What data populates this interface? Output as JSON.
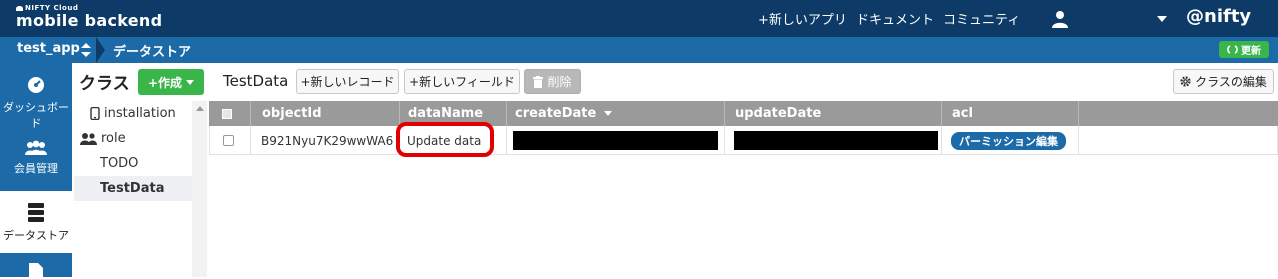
{
  "header": {
    "logo_small": "NIFTY Cloud",
    "logo_big": "mobile backend",
    "nav": [
      {
        "label": "+新しいアプリ"
      },
      {
        "label": "ドキュメント"
      },
      {
        "label": "コミュニティ"
      }
    ],
    "brand": "@nifty"
  },
  "subbar": {
    "app_name": "test_app",
    "breadcrumb": "データストア",
    "refresh_label": "更新"
  },
  "sidebar": {
    "items": [
      {
        "label": "ダッシュボード",
        "icon": "gauge-icon"
      },
      {
        "label": "会員管理",
        "icon": "users-icon"
      },
      {
        "label": "データストア",
        "icon": "database-icon"
      },
      {
        "label": "",
        "icon": "file-icon"
      }
    ]
  },
  "classes": {
    "title": "クラス",
    "create_label": "+作成",
    "items": [
      {
        "label": "installation",
        "icon": "mobile-icon"
      },
      {
        "label": "role",
        "icon": "users-icon"
      },
      {
        "label": "TODO"
      },
      {
        "label": "TestData",
        "selected": true
      }
    ]
  },
  "toolbar": {
    "class_name": "TestData",
    "new_record": "+新しいレコード",
    "new_field": "+新しいフィールド",
    "delete": "削除",
    "edit_class": "クラスの編集"
  },
  "table": {
    "columns": [
      "objectId",
      "dataName",
      "createDate",
      "updateDate",
      "acl"
    ],
    "rows": [
      {
        "objectId": "B921Nyu7K29wwWA6",
        "dataName": "Update data",
        "createDate": "",
        "updateDate": "",
        "acl": "パーミッション編集"
      }
    ]
  },
  "colors": {
    "topbar": "#0d3a66",
    "subbar": "#1c6aa8",
    "accent_green": "#39b54a",
    "highlight_red": "#e00000"
  }
}
